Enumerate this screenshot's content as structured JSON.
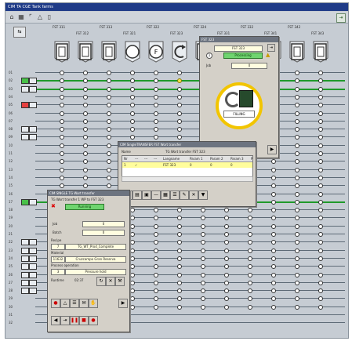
{
  "window_title": "CIM TA  CGE Tank farms",
  "tanks": [
    {
      "label": "FST 311",
      "icon": "tank-filled-icon"
    },
    {
      "label": "FST 312",
      "icon": "tank-filled-icon"
    },
    {
      "label": "FST 313",
      "icon": "tank-filled-icon"
    },
    {
      "label": "FST 321",
      "icon": "tank-empty-icon"
    },
    {
      "label": "FST 322",
      "icon": "tank-f-icon"
    },
    {
      "label": "FST 323",
      "icon": "tank-filling-icon"
    },
    {
      "label": "FST 324",
      "icon": "tank-filled-icon"
    },
    {
      "label": "FST 331",
      "icon": "tank-filled-icon"
    },
    {
      "label": "FST 332",
      "icon": "tank-filled-icon"
    },
    {
      "label": "FST 341",
      "icon": "tank-filled-icon"
    },
    {
      "label": "FST 342",
      "icon": "tank-filled-icon"
    },
    {
      "label": "FST 343",
      "icon": "tank-filled-icon"
    }
  ],
  "rows": [
    "01",
    "02",
    "03",
    "04",
    "05",
    "06",
    "07",
    "08",
    "09",
    "10",
    "11",
    "12",
    "13",
    "14",
    "15",
    "16",
    "17",
    "18",
    "19",
    "20",
    "21",
    "22",
    "23",
    "24",
    "25",
    "26",
    "27",
    "28",
    "29",
    "30",
    "31",
    "32"
  ],
  "tank_window": {
    "title": "FST 323",
    "tank_field": "FST 323",
    "status": "Processing",
    "job_label": "Job",
    "job_value": "0",
    "gauge_label": "FILLING"
  },
  "transfer_window": {
    "title": "CIM SingleTRANSFER   FST Wort transfer",
    "name_label": "Name",
    "name_value": "TG Wort transfer FST 323",
    "columns": [
      "Nr",
      "---",
      "---",
      "---",
      "Langname",
      "Param 1",
      "Param 2",
      "Param 3",
      "P"
    ],
    "row": [
      "1",
      "✓",
      "",
      "",
      "FST 323",
      "0",
      "0",
      "0",
      ""
    ]
  },
  "control_window": {
    "title": "CIM SINGLE TG Wort transfer",
    "subtitle": "TG Wort transfer 1 WP to FST 323",
    "status": "Running",
    "job_label": "Job",
    "job_value": "0",
    "batch_label": "Batch",
    "batch_value": "0",
    "recipe_label": "Recipe",
    "recipe_nr": "7",
    "recipe_name": "TG_WT_Prod_Complete",
    "material_label": "Material",
    "material_nr": "11632",
    "material_name": "Cruzcampo Gran Reserva",
    "operation_label": "Process operation",
    "operation_nr": "3",
    "operation_name": "Pressure hold",
    "runtime_label": "Runtime",
    "runtime_value": "02:37"
  }
}
